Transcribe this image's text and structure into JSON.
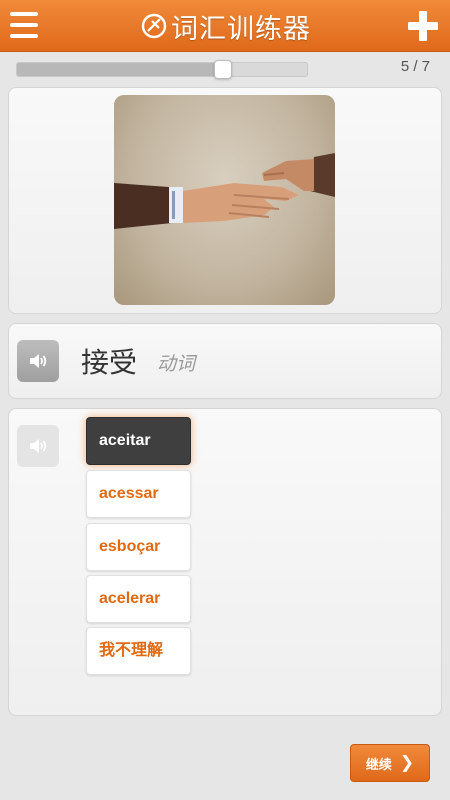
{
  "header": {
    "title": "词汇训练器",
    "menu_icon": "menu-icon",
    "add_icon": "plus-icon",
    "brand_color": "#e8771f"
  },
  "progress": {
    "current": 5,
    "total": 7,
    "label": "5 / 7",
    "fraction": 0.71
  },
  "card": {
    "image_icon": "handshake-photo",
    "word": "接受",
    "part_of_speech": "动词",
    "speaker_icon": "speaker-icon"
  },
  "options": [
    {
      "label": "aceitar",
      "selected": true
    },
    {
      "label": "acessar",
      "selected": false
    },
    {
      "label": "esboçar",
      "selected": false
    },
    {
      "label": "acelerar",
      "selected": false
    },
    {
      "label": "我不理解",
      "selected": false
    }
  ],
  "footer": {
    "continue_label": "继续",
    "continue_icon": "chevron-right-icon"
  },
  "colors": {
    "accent": "#e8771f",
    "option_text": "#e06a12",
    "selected_bg": "#3f3f3f"
  }
}
